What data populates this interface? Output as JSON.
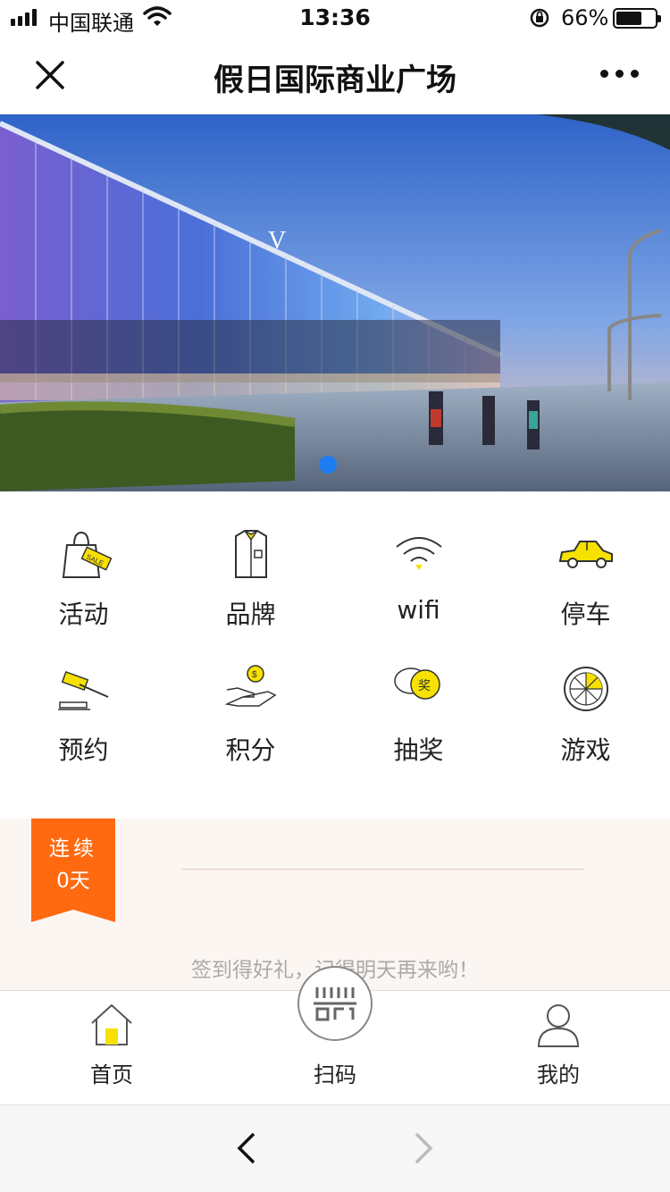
{
  "status_bar": {
    "carrier": "中国联通",
    "time": "13:36",
    "battery_percent": "66%",
    "battery_level": 0.66
  },
  "navbar": {
    "title": "假日国际商业广场"
  },
  "banner": {
    "slide_count": 1,
    "active_index": 0
  },
  "menu": {
    "items": [
      {
        "label": "活动",
        "icon": "sale-bag-icon"
      },
      {
        "label": "品牌",
        "icon": "shirt-icon"
      },
      {
        "label": "wifi",
        "icon": "wifi-icon"
      },
      {
        "label": "停车",
        "icon": "car-icon"
      },
      {
        "label": "预约",
        "icon": "gavel-icon"
      },
      {
        "label": "积分",
        "icon": "coin-hand-icon"
      },
      {
        "label": "抽奖",
        "icon": "prize-bubble-icon"
      },
      {
        "label": "游戏",
        "icon": "wheel-icon"
      }
    ]
  },
  "checkin": {
    "ribbon_line1": "连续",
    "ribbon_line2": "0天",
    "message": "签到得好礼，记得明天再来哟！"
  },
  "tabbar": {
    "home": "首页",
    "scan": "扫码",
    "mine": "我的"
  },
  "colors": {
    "accent_yellow": "#f7e100",
    "ribbon_orange": "#ff6a10",
    "pager_blue": "#1e7bf0",
    "checkin_bg": "#fcf6f3"
  }
}
